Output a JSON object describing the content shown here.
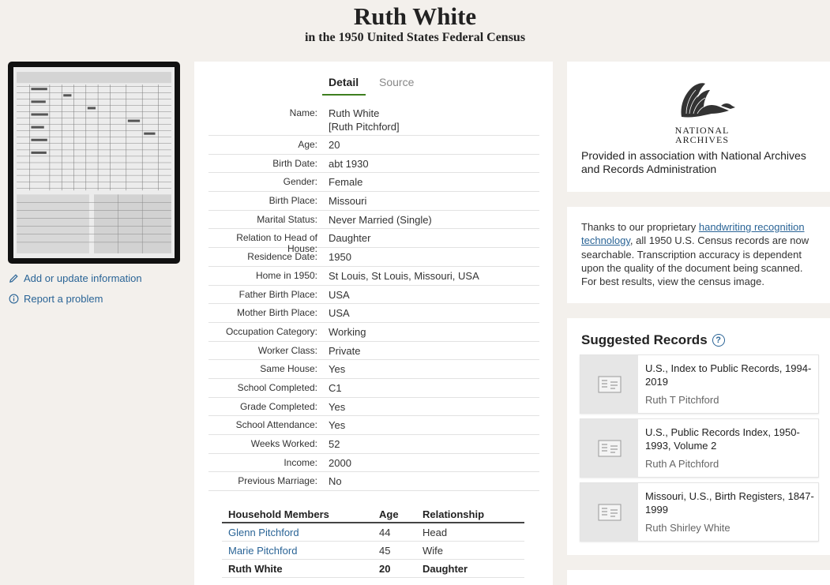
{
  "header": {
    "name": "Ruth White",
    "subtitle": "in the 1950 United States Federal Census"
  },
  "side_links": {
    "add_update": "Add or update information",
    "report": "Report a problem"
  },
  "tabs": {
    "detail": "Detail",
    "source": "Source"
  },
  "facts": [
    {
      "label": "Name:",
      "value": "Ruth White",
      "value2": "[Ruth Pitchford]"
    },
    {
      "label": "Age:",
      "value": "20"
    },
    {
      "label": "Birth Date:",
      "value": "abt 1930"
    },
    {
      "label": "Gender:",
      "value": "Female"
    },
    {
      "label": "Birth Place:",
      "value": "Missouri"
    },
    {
      "label": "Marital Status:",
      "value": "Never Married (Single)"
    },
    {
      "label": "Relation to Head of House:",
      "value": "Daughter"
    },
    {
      "label": "Residence Date:",
      "value": "1950"
    },
    {
      "label": "Home in 1950:",
      "value": "St Louis, St Louis, Missouri, USA"
    },
    {
      "label": "Father Birth Place:",
      "value": "USA"
    },
    {
      "label": "Mother Birth Place:",
      "value": "USA"
    },
    {
      "label": "Occupation Category:",
      "value": "Working"
    },
    {
      "label": "Worker Class:",
      "value": "Private"
    },
    {
      "label": "Same House:",
      "value": "Yes"
    },
    {
      "label": "School Completed:",
      "value": "C1"
    },
    {
      "label": "Grade Completed:",
      "value": "Yes"
    },
    {
      "label": "School Attendance:",
      "value": "Yes"
    },
    {
      "label": "Weeks Worked:",
      "value": "52"
    },
    {
      "label": "Income:",
      "value": "2000"
    },
    {
      "label": "Previous Marriage:",
      "value": "No"
    }
  ],
  "household": {
    "headers": [
      "Household Members",
      "Age",
      "Relationship"
    ],
    "rows": [
      {
        "name": "Glenn Pitchford",
        "age": "44",
        "relationship": "Head"
      },
      {
        "name": "Marie Pitchford",
        "age": "45",
        "relationship": "Wife"
      },
      {
        "name": "Ruth White",
        "age": "20",
        "relationship": "Daughter"
      }
    ]
  },
  "na": {
    "logo_line1": "NATIONAL",
    "logo_line2": "ARCHIVES",
    "text": "Provided in association with National Archives and Records Administration"
  },
  "ocr": {
    "before": "Thanks to our proprietary ",
    "link": "handwriting recognition technology",
    "after": ", all 1950 U.S. Census records are now searchable. Transcription accuracy is dependent upon the quality of the document being scanned. For best results, view the census image."
  },
  "suggested": {
    "title": "Suggested Records",
    "help": "?",
    "records": [
      {
        "title": "U.S., Index to Public Records, 1994-2019",
        "name": "Ruth T Pitchford"
      },
      {
        "title": "U.S., Public Records Index, 1950-1993, Volume 2",
        "name": "Ruth A Pitchford"
      },
      {
        "title": "Missouri, U.S., Birth Registers, 1847-1999",
        "name": "Ruth Shirley White"
      }
    ]
  },
  "colors": {
    "link": "#2a6496",
    "tab_accent": "#3e7f1f",
    "background": "#f3f0ec"
  }
}
